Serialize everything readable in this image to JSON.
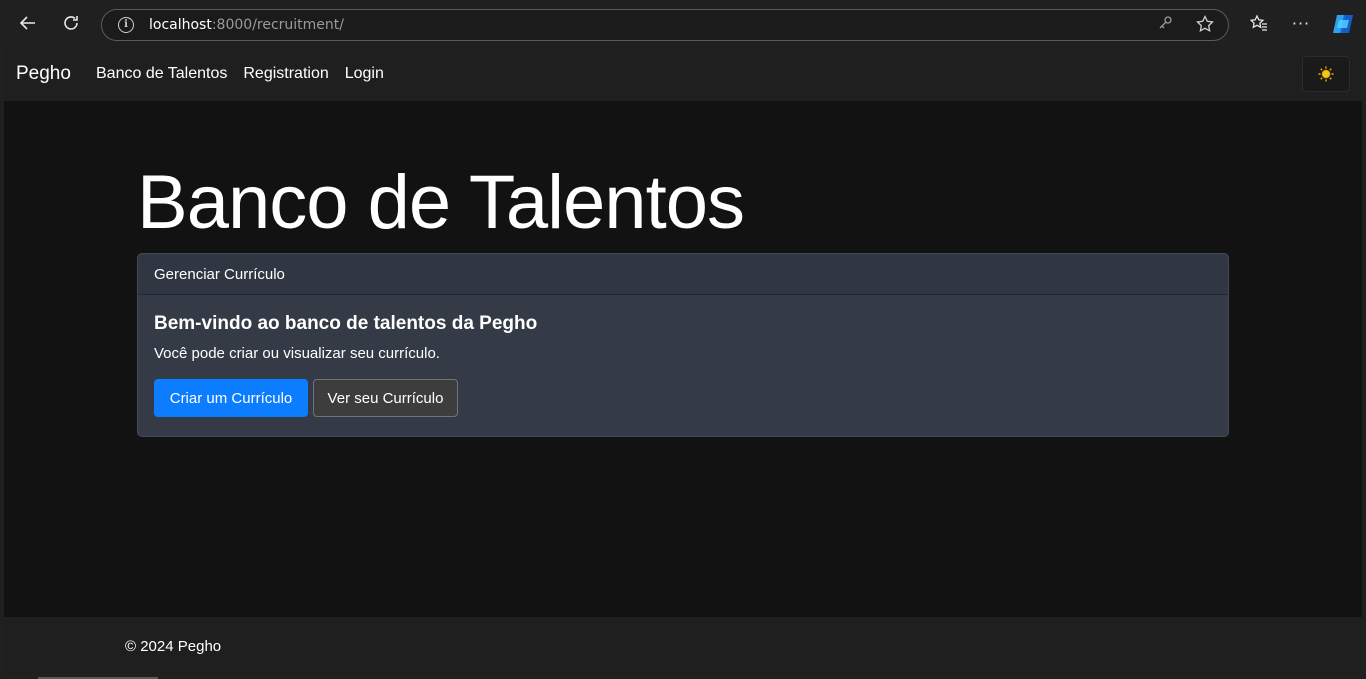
{
  "browser": {
    "url_host": "localhost",
    "url_rest": ":8000/recruitment/"
  },
  "navbar": {
    "brand": "Pegho",
    "links": [
      {
        "label": "Banco de Talentos"
      },
      {
        "label": "Registration"
      },
      {
        "label": "Login"
      }
    ],
    "theme_toggle_icon": "sun-icon"
  },
  "main": {
    "title": "Banco de Talentos",
    "card": {
      "header": "Gerenciar Currículo",
      "title": "Bem-vindo ao banco de talentos da Pegho",
      "text": "Você pode criar ou visualizar seu currículo.",
      "primary_button": "Criar um Currículo",
      "secondary_button": "Ver seu Currículo"
    }
  },
  "footer": {
    "text": "© 2024 Pegho"
  },
  "colors": {
    "primary": "#0d7dff",
    "background": "#121212",
    "navbar": "#1f1f1f",
    "card": "#343a46"
  }
}
